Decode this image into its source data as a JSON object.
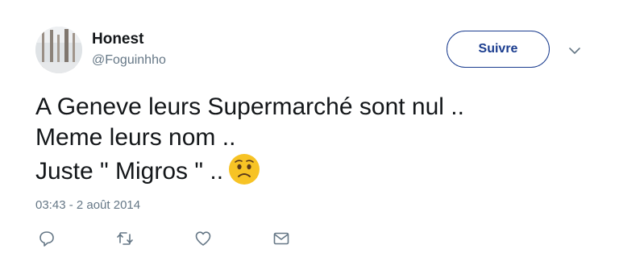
{
  "user": {
    "display_name": "Honest",
    "handle": "@Foguinhho"
  },
  "follow_button": {
    "label": "Suivre"
  },
  "tweet": {
    "lines": [
      "A Geneve leurs Supermarché sont nul ..",
      "Meme leurs nom ..",
      "Juste \" Migros \" .."
    ],
    "emoji": "worried-face-icon",
    "timestamp": "03:43 - 2 août 2014"
  },
  "actions": [
    {
      "name": "reply-icon"
    },
    {
      "name": "retweet-icon"
    },
    {
      "name": "like-icon"
    },
    {
      "name": "direct-message-icon"
    }
  ],
  "colors": {
    "follow_border": "#1b3d8f",
    "secondary_text": "#657786",
    "primary_text": "#14171a",
    "action_icon": "#657786"
  }
}
